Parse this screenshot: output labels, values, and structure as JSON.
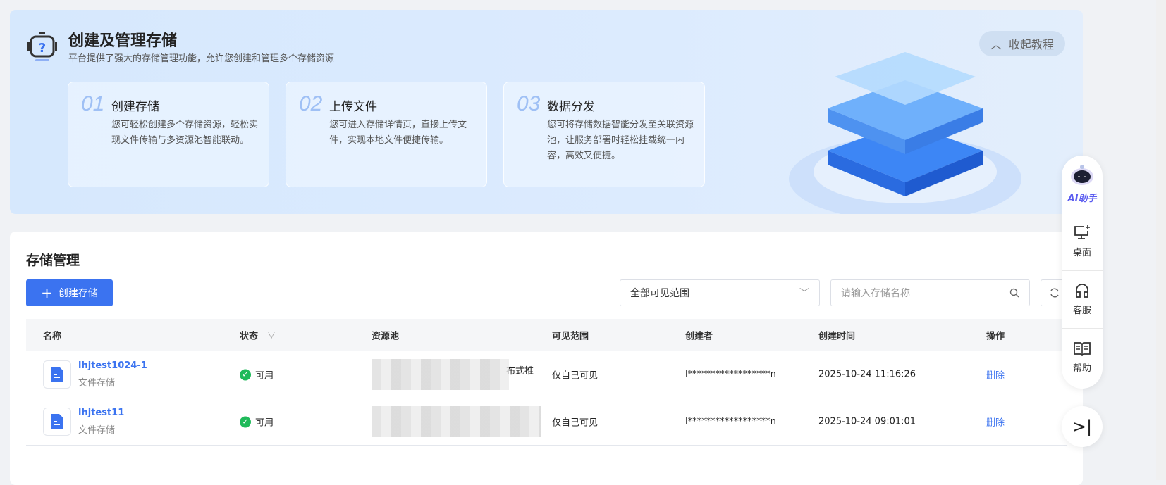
{
  "banner": {
    "title": "创建及管理存储",
    "subtitle": "平台提供了强大的存储管理功能，允许您创建和管理多个存储资源",
    "collapse_label": "收起教程",
    "steps": [
      {
        "num": "01",
        "title": "创建存储",
        "desc": "您可轻松创建多个存储资源，轻松实现文件传输与多资源池智能联动。"
      },
      {
        "num": "02",
        "title": "上传文件",
        "desc": "您可进入存储详情页，直接上传文件，实现本地文件便捷传输。"
      },
      {
        "num": "03",
        "title": "数据分发",
        "desc": "您可将存储数据智能分发至关联资源池，让服务部署时轻松挂载统一内容，高效又便捷。"
      }
    ]
  },
  "main": {
    "title": "存储管理",
    "create_label": "创建存储",
    "scope_select": "全部可见范围",
    "search_placeholder": "请输入存储名称",
    "columns": [
      "名称",
      "状态",
      "资源池",
      "可见范围",
      "创建者",
      "创建时间",
      "操作"
    ],
    "rows": [
      {
        "name": "lhjtest1024-1",
        "type": "文件存储",
        "status": "可用",
        "pool_visible": "布式推",
        "visibility": "仅自己可见",
        "creator": "l******************n",
        "created": "2025-10-24 11:16:26",
        "action": "删除"
      },
      {
        "name": "lhjtest11",
        "type": "文件存储",
        "status": "可用",
        "pool_visible": "",
        "visibility": "仅自己可见",
        "creator": "l******************n",
        "created": "2025-10-24 09:01:01",
        "action": "删除"
      }
    ]
  },
  "float": {
    "ai": "AI助手",
    "desktop": "桌面",
    "service": "客服",
    "help": "帮助"
  },
  "colors": {
    "primary": "#3b73f0",
    "success": "#1fba5a"
  }
}
